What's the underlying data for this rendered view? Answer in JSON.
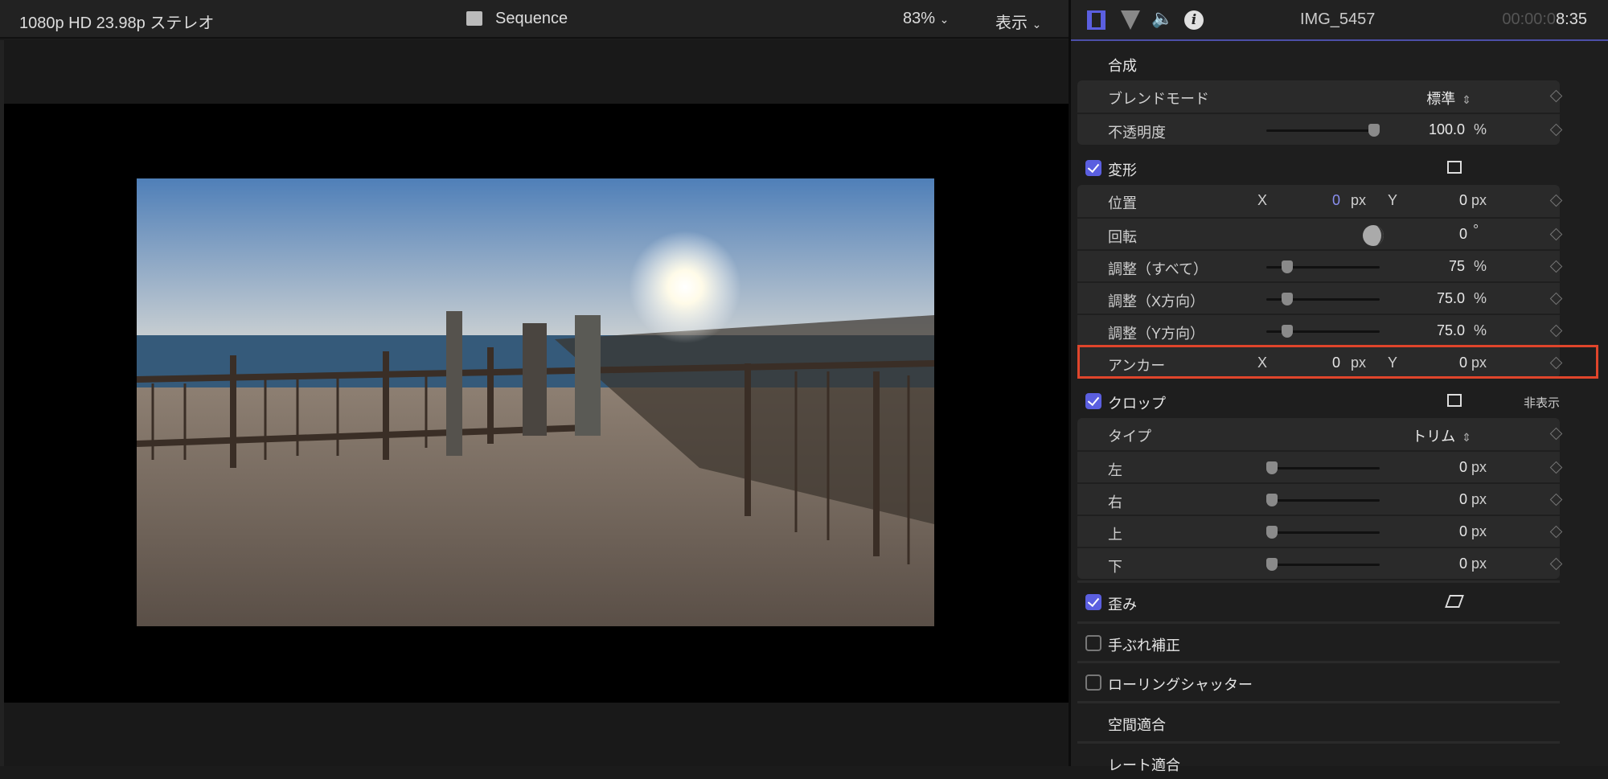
{
  "viewer": {
    "format": "1080p HD 23.98p ステレオ",
    "title": "Sequence",
    "zoom": "83%",
    "view_menu": "表示"
  },
  "inspector": {
    "clip_name": "IMG_5457",
    "timecode_dim": "00:00:0",
    "timecode": "8:35",
    "tabs": [
      "video-inspector",
      "color-inspector",
      "audio-inspector",
      "info-inspector"
    ],
    "sections": [
      {
        "id": "composite",
        "label": "合成",
        "rows": [
          {
            "kind": "popup",
            "label": "ブレンドモード",
            "value": "標準"
          },
          {
            "kind": "slider",
            "label": "不透明度",
            "value": "100.0",
            "unit": "%",
            "fraction": 1.0
          }
        ]
      },
      {
        "id": "transform",
        "label": "変形",
        "checked": true,
        "rows": [
          {
            "kind": "xy",
            "label": "位置",
            "x": "0",
            "y": "0",
            "unit": "px",
            "x_label": "X",
            "y_label": "Y"
          },
          {
            "kind": "dial",
            "label": "回転",
            "value": "0",
            "unit": "°"
          },
          {
            "kind": "slider",
            "label": "調整（すべて）",
            "value": "75",
            "unit": "%",
            "fraction": 0.15
          },
          {
            "kind": "slider",
            "label": "調整（X方向）",
            "value": "75.0",
            "unit": "%",
            "fraction": 0.15
          },
          {
            "kind": "slider",
            "label": "調整（Y方向）",
            "value": "75.0",
            "unit": "%",
            "fraction": 0.15
          },
          {
            "kind": "xy",
            "label": "アンカー",
            "x": "0",
            "y": "0",
            "unit": "px",
            "x_label": "X",
            "y_label": "Y",
            "highlighted": true
          }
        ]
      },
      {
        "id": "crop",
        "label": "クロップ",
        "checked": true,
        "extra": "非表示",
        "rows": [
          {
            "kind": "popup",
            "label": "タイプ",
            "value": "トリム"
          },
          {
            "kind": "slider",
            "label": "左",
            "value": "0",
            "unit": "px",
            "fraction": 0
          },
          {
            "kind": "slider",
            "label": "右",
            "value": "0",
            "unit": "px",
            "fraction": 0
          },
          {
            "kind": "slider",
            "label": "上",
            "value": "0",
            "unit": "px",
            "fraction": 0
          },
          {
            "kind": "slider",
            "label": "下",
            "value": "0",
            "unit": "px",
            "fraction": 0
          }
        ]
      },
      {
        "id": "distort",
        "label": "歪み",
        "checked": true,
        "rows": []
      },
      {
        "id": "stabilization",
        "label": "手ぶれ補正",
        "checked": false,
        "rows": []
      },
      {
        "id": "rolling-shutter",
        "label": "ローリングシャッター",
        "checked": false,
        "rows": []
      },
      {
        "id": "spatial-conform",
        "label": "空間適合",
        "rows": []
      },
      {
        "id": "rate-conform",
        "label": "レート適合",
        "rows": []
      }
    ],
    "accent": "#5b5fe0",
    "highlight": "#e0452b"
  }
}
